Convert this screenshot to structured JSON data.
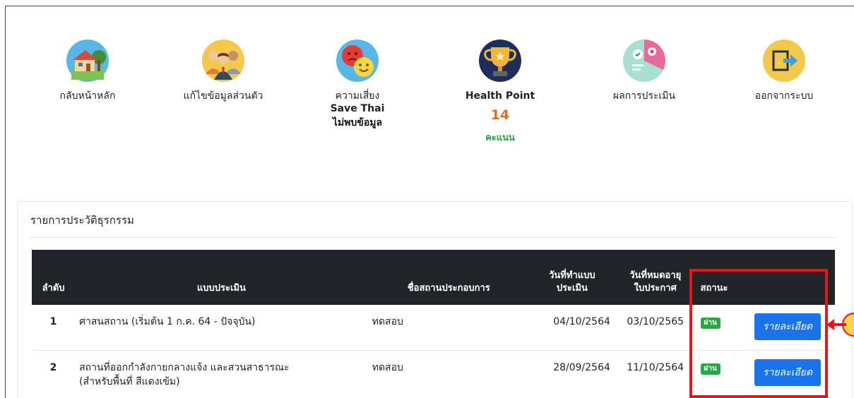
{
  "nav": {
    "items": [
      {
        "label": "กลับหน้าหลัก",
        "icon": "home-icon"
      },
      {
        "label": "แก้ไขข้อมูลส่วนตัว",
        "icon": "people-icon"
      },
      {
        "label": "ความเสี่ยง",
        "sub": "Save Thai",
        "value": "ไม่พบข้อมูล",
        "icon": "risk-faces-icon"
      },
      {
        "label": "Health Point",
        "score": "14",
        "unit": "คะแนน",
        "icon": "trophy-icon"
      },
      {
        "label": "ผลการประเมิน",
        "icon": "evaluation-icon"
      },
      {
        "label": "ออกจากระบบ",
        "icon": "logout-icon"
      }
    ]
  },
  "history": {
    "title": "รายการประวัติธุรกรรม",
    "columns": {
      "no": "ลำดับ",
      "form": "แบบประเมิน",
      "shop": "ชื่อสถานประกอบการ",
      "date_done_1": "วันที่ทำแบบ",
      "date_done_2": "ประเมิน",
      "date_exp_1": "วันที่หมดอายุ",
      "date_exp_2": "ใบประกาศ",
      "status": "สถานะ"
    },
    "rows": [
      {
        "no": "1",
        "form": "ศาสนสถาน (เริ่มต้น 1 ก.ค. 64 - ปัจจุบัน)",
        "form2": "",
        "shop": "ทดสอบ",
        "date_done": "04/10/2564",
        "date_exp": "03/10/2565",
        "status": "ผ่าน",
        "action": "รายละเอียด"
      },
      {
        "no": "2",
        "form": "สถานที่ออกกำลังกายกลางแจ้ง และสวนสาธารณะ",
        "form2": "(สำหรับพื้นที่ สีแดงเข้ม)",
        "shop": "ทดสอบ",
        "date_done": "28/09/2564",
        "date_exp": "11/10/2564",
        "status": "ผ่าน",
        "action": "รายละเอียด"
      }
    ]
  },
  "colors": {
    "score": "#f06a1a",
    "unit": "#2e9b4a",
    "table_header": "#212529",
    "badge": "#28a745",
    "button": "#1a73e8",
    "annotation": "#e8131d"
  }
}
